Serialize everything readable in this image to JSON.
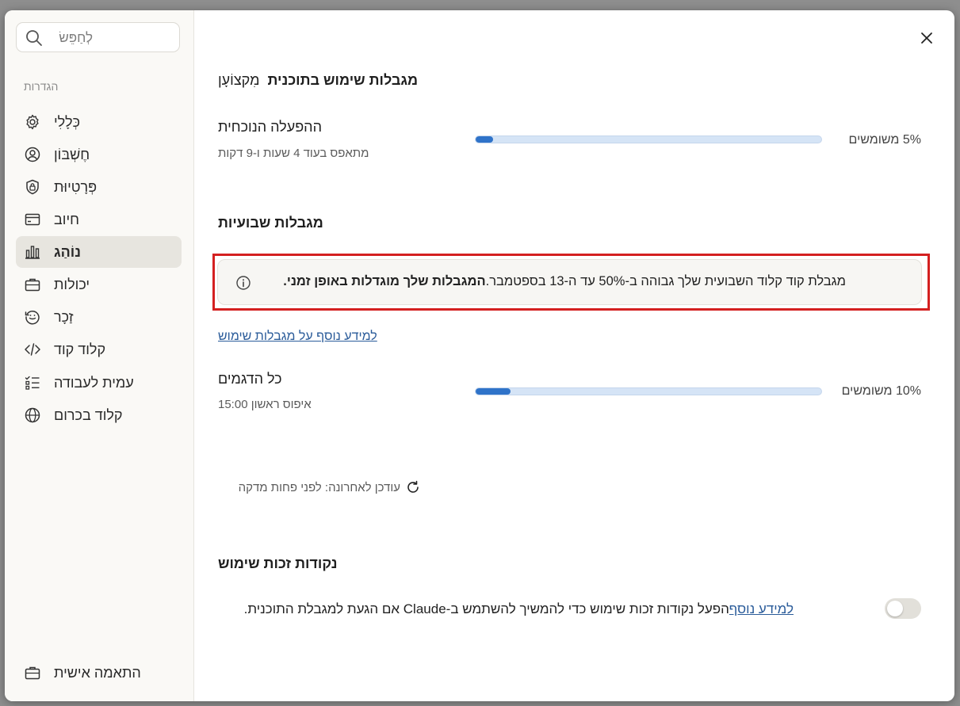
{
  "search": {
    "placeholder": "לְחַפֵּשׂ"
  },
  "sidebar": {
    "section_label": "הגדרות",
    "items": [
      {
        "label": "כְּלָלִי",
        "icon": "gear-icon"
      },
      {
        "label": "חֶשְׁבּוֹן",
        "icon": "account-icon"
      },
      {
        "label": "פְּרָטִיוּת",
        "icon": "privacy-shield-icon"
      },
      {
        "label": "חיוב",
        "icon": "billing-card-icon"
      },
      {
        "label": "נוֹהַג",
        "icon": "usage-chart-icon",
        "active": true
      },
      {
        "label": "יכולות",
        "icon": "briefcase-icon"
      },
      {
        "label": "זַכָר",
        "icon": "memory-icon"
      },
      {
        "label": "קלוד קוד",
        "icon": "code-icon"
      },
      {
        "label": "עמית לעבודה",
        "icon": "checklist-icon"
      },
      {
        "label": "קלוד בכרום",
        "icon": "globe-icon"
      }
    ],
    "bottom_item": {
      "label": "התאמה אישית",
      "icon": "briefcase-icon"
    }
  },
  "plan": {
    "title": "מגבלות שימוש בתוכנית",
    "tier": "מִקצוֹעָן"
  },
  "current_session": {
    "title": "ההפעלה הנוכחית",
    "reset": "מתאפס בעוד 4 שעות ו-9 דקות",
    "percent_text": "5% משומשים",
    "percent": 5
  },
  "weekly": {
    "title": "מגבלות שבועיות"
  },
  "notice": {
    "text": "מגבלת קוד קלוד השבועית שלך גבוהה ב-50% עד ה-13 בספטמבר.",
    "bold_text": "המגבלות שלך מוגדלות באופן זמני."
  },
  "learn_more_limits": "למידע נוסף על מגבלות שימוש",
  "all_models": {
    "title": "כל הדגמים",
    "reset": "איפוס ראשון 15:00",
    "percent_text": "10% משומשים",
    "percent": 10
  },
  "last_updated": "עודכן לאחרונה: לפני פחות מדקה",
  "credits": {
    "title": "נקודות זכות שימוש",
    "learn_more": "למידע נוסף",
    "description": "הפעל נקודות זכות שימוש כדי להמשיך להשתמש ב-Claude אם הגעת למגבלת התוכנית.",
    "enabled": false
  },
  "colors": {
    "accent": "#2f73c9",
    "highlight_border": "#d42020"
  }
}
